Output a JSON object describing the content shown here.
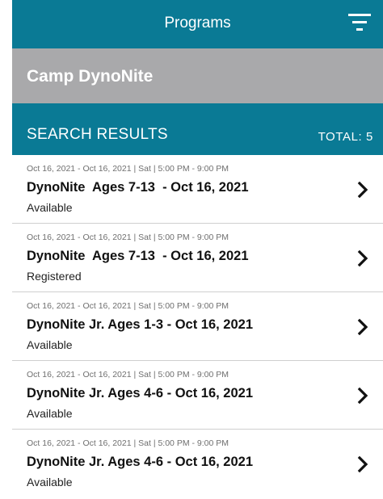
{
  "header": {
    "title": "Programs"
  },
  "camp": {
    "name": "Camp DynoNite"
  },
  "results": {
    "title": "SEARCH RESULTS",
    "total": "TOTAL: 5"
  },
  "programs": [
    {
      "dates": "Oct 16, 2021 - Oct 16, 2021 | Sat | 5:00 PM - 9:00 PM",
      "title": "DynoNite  Ages 7-13  - Oct 16, 2021",
      "status": "Available"
    },
    {
      "dates": "Oct 16, 2021 - Oct 16, 2021 | Sat | 5:00 PM - 9:00 PM",
      "title": "DynoNite  Ages 7-13  - Oct 16, 2021",
      "status": "Registered"
    },
    {
      "dates": "Oct 16, 2021 - Oct 16, 2021 | Sat | 5:00 PM - 9:00 PM",
      "title": "DynoNite Jr. Ages 1-3 - Oct 16, 2021",
      "status": "Available"
    },
    {
      "dates": "Oct 16, 2021 - Oct 16, 2021 | Sat | 5:00 PM - 9:00 PM",
      "title": "DynoNite Jr. Ages 4-6 - Oct 16, 2021",
      "status": "Available"
    },
    {
      "dates": "Oct 16, 2021 - Oct 16, 2021 | Sat | 5:00 PM - 9:00 PM",
      "title": "DynoNite Jr. Ages 4-6 - Oct 16, 2021",
      "status": "Available"
    }
  ],
  "icons": {
    "filter": "filter-icon",
    "chevron": "chevron-right-icon"
  },
  "colors": {
    "primary": "#0a7a95",
    "banner": "#a9a9ab"
  }
}
